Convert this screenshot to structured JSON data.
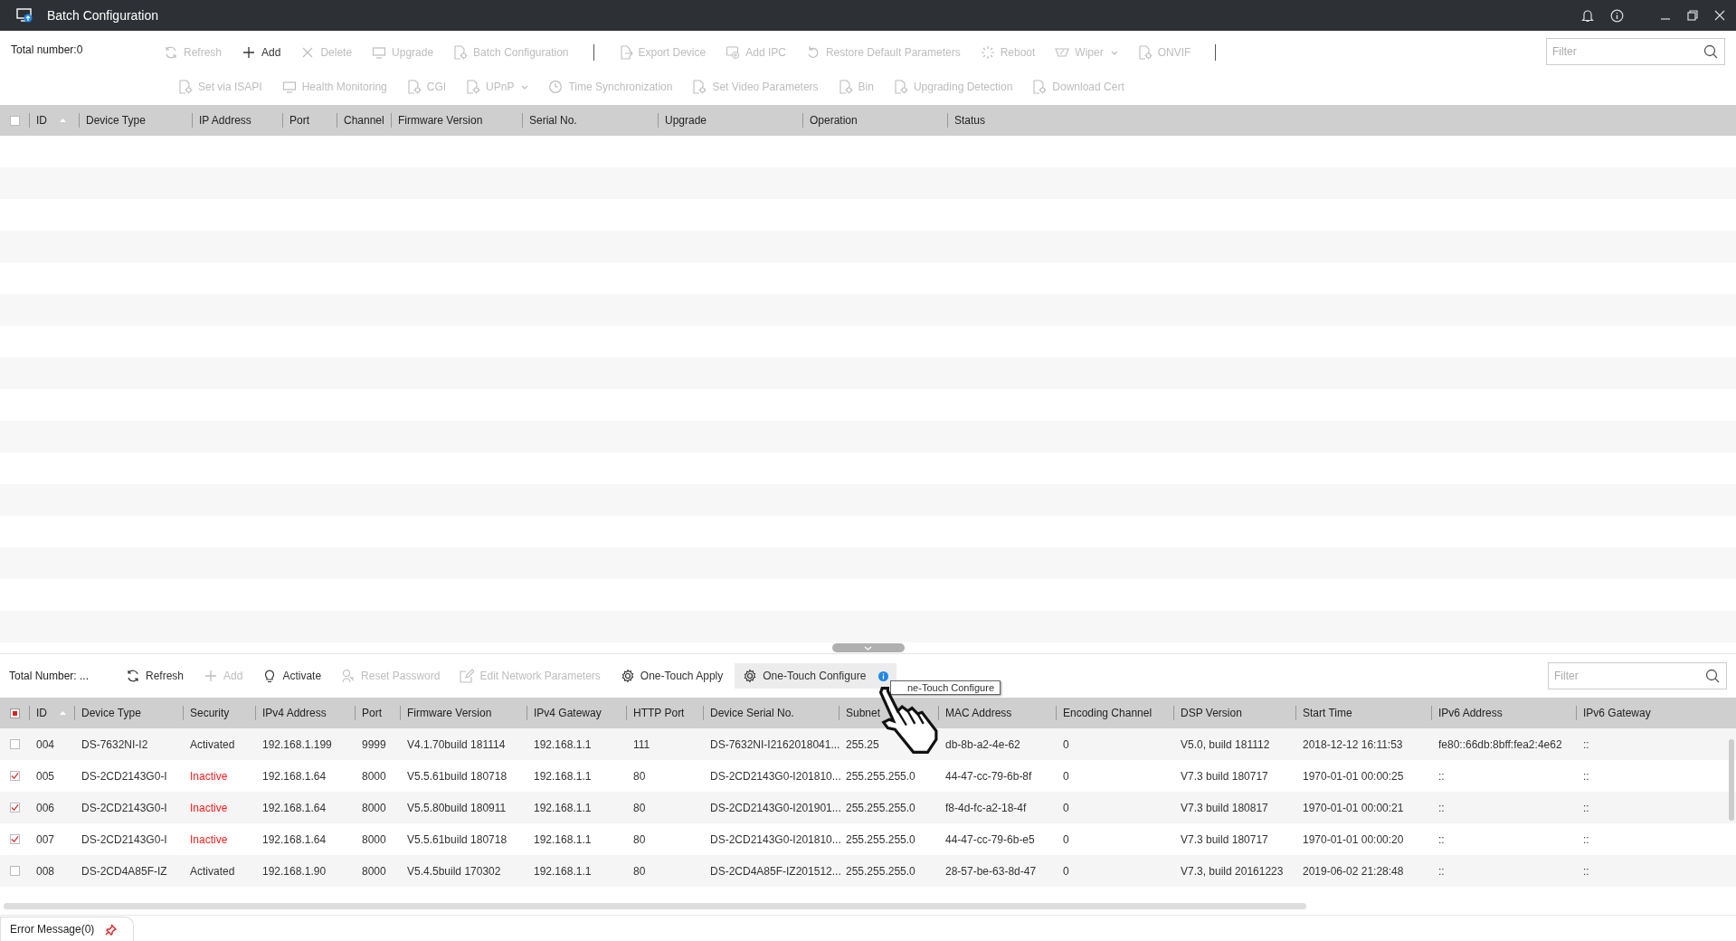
{
  "window": {
    "title": "Batch Configuration"
  },
  "upper": {
    "total": "Total number:0",
    "toolbar_rows": [
      [
        {
          "kind": "button",
          "label": "Refresh",
          "disabled": true
        },
        {
          "kind": "button",
          "label": "Add",
          "disabled": false
        },
        {
          "kind": "button",
          "label": "Delete",
          "disabled": true
        },
        {
          "kind": "button",
          "label": "Upgrade",
          "disabled": true
        },
        {
          "kind": "button",
          "label": "Batch Configuration",
          "disabled": true
        },
        {
          "kind": "separator"
        },
        {
          "kind": "button",
          "label": "Export Device",
          "disabled": true
        },
        {
          "kind": "button",
          "label": "Add IPC",
          "disabled": true
        },
        {
          "kind": "button",
          "label": "Restore Default Parameters",
          "disabled": true
        },
        {
          "kind": "button",
          "label": "Reboot",
          "disabled": true
        },
        {
          "kind": "dropdown",
          "label": "Wiper",
          "disabled": true
        },
        {
          "kind": "button",
          "label": "ONVIF",
          "disabled": true
        },
        {
          "kind": "separator"
        }
      ],
      [
        {
          "kind": "button",
          "label": "Set via ISAPI",
          "disabled": true
        },
        {
          "kind": "button",
          "label": "Health Monitoring",
          "disabled": true
        },
        {
          "kind": "button",
          "label": "CGI",
          "disabled": true
        },
        {
          "kind": "dropdown",
          "label": "UPnP",
          "disabled": true
        },
        {
          "kind": "button",
          "label": "Time Synchronization",
          "disabled": true
        },
        {
          "kind": "button",
          "label": "Set Video Parameters",
          "disabled": true
        },
        {
          "kind": "button",
          "label": "Bin",
          "disabled": true
        },
        {
          "kind": "button",
          "label": "Upgrading Detection",
          "disabled": true
        },
        {
          "kind": "button",
          "label": "Download Cert",
          "disabled": true
        }
      ]
    ],
    "filter": {
      "placeholder": "Filter"
    },
    "table": {
      "header_checked": false,
      "columns": [
        "ID",
        "Device Type",
        "IP Address",
        "Port",
        "Channel",
        "Firmware Version",
        "Serial No.",
        "Upgrade",
        "Operation",
        "Status"
      ]
    }
  },
  "lower": {
    "total": "Total Number: ...",
    "toolbar": [
      {
        "label": "Refresh",
        "disabled": false,
        "hovered": false,
        "info": false
      },
      {
        "label": "Add",
        "disabled": true,
        "hovered": false,
        "info": false
      },
      {
        "label": "Activate",
        "disabled": false,
        "hovered": false,
        "info": false
      },
      {
        "label": "Reset Password",
        "disabled": true,
        "hovered": false,
        "info": false
      },
      {
        "label": "Edit Network Parameters",
        "disabled": true,
        "hovered": false,
        "info": false
      },
      {
        "label": "One-Touch Apply",
        "disabled": false,
        "hovered": false,
        "info": false
      },
      {
        "label": "One-Touch Configure",
        "disabled": false,
        "hovered": true,
        "info": true
      }
    ],
    "tooltip": "ne-Touch Configure",
    "filter": {
      "placeholder": "Filter"
    },
    "table": {
      "header_checked": true,
      "columns": [
        "ID",
        "Device Type",
        "Security",
        "IPv4 Address",
        "Port",
        "Firmware Version",
        "IPv4 Gateway",
        "HTTP Port",
        "Device Serial No.",
        "Subnet",
        "MAC Address",
        "Encoding Channel",
        "DSP Version",
        "Start Time",
        "IPv6 Address",
        "IPv6 Gateway"
      ],
      "rows": [
        {
          "checked": false,
          "inactive": false,
          "cells": [
            "004",
            "DS-7632NI-I2",
            "Activated",
            "192.168.1.199",
            "9999",
            "V4.1.70build 181114",
            "192.168.1.1",
            "111",
            "DS-7632NI-I2162018041...",
            "255.25",
            "db-8b-a2-4e-62",
            "0",
            "V5.0, build 181112",
            "2018-12-12 16:11:53",
            "fe80::66db:8bff:fea2:4e62",
            "::"
          ]
        },
        {
          "checked": true,
          "inactive": true,
          "cells": [
            "005",
            "DS-2CD2143G0-I",
            "Inactive",
            "192.168.1.64",
            "8000",
            "V5.5.61build 180718",
            "192.168.1.1",
            "80",
            "DS-2CD2143G0-I201810...",
            "255.255.255.0",
            "44-47-cc-79-6b-8f",
            "0",
            "V7.3 build 180717",
            "1970-01-01 00:00:25",
            "::",
            "::"
          ]
        },
        {
          "checked": true,
          "inactive": true,
          "cells": [
            "006",
            "DS-2CD2143G0-I",
            "Inactive",
            "192.168.1.64",
            "8000",
            "V5.5.80build 180911",
            "192.168.1.1",
            "80",
            "DS-2CD2143G0-I201901...",
            "255.255.255.0",
            "f8-4d-fc-a2-18-4f",
            "0",
            "V7.3 build 180817",
            "1970-01-01 00:00:21",
            "::",
            "::"
          ]
        },
        {
          "checked": true,
          "inactive": true,
          "cells": [
            "007",
            "DS-2CD2143G0-I",
            "Inactive",
            "192.168.1.64",
            "8000",
            "V5.5.61build 180718",
            "192.168.1.1",
            "80",
            "DS-2CD2143G0-I201810...",
            "255.255.255.0",
            "44-47-cc-79-6b-e5",
            "0",
            "V7.3 build 180717",
            "1970-01-01 00:00:20",
            "::",
            "::"
          ]
        },
        {
          "checked": false,
          "inactive": false,
          "cells": [
            "008",
            "DS-2CD4A85F-IZ",
            "Activated",
            "192.168.1.90",
            "8000",
            "V5.4.5build 170302",
            "192.168.1.1",
            "80",
            "DS-2CD4A85F-IZ201512...",
            "255.255.255.0",
            "28-57-be-63-8d-47",
            "0",
            "V7.3, build 20161223",
            "2019-06-02 21:28:48",
            "::",
            "::"
          ]
        }
      ]
    }
  },
  "error_tab": {
    "label": "Error Message(0)"
  }
}
